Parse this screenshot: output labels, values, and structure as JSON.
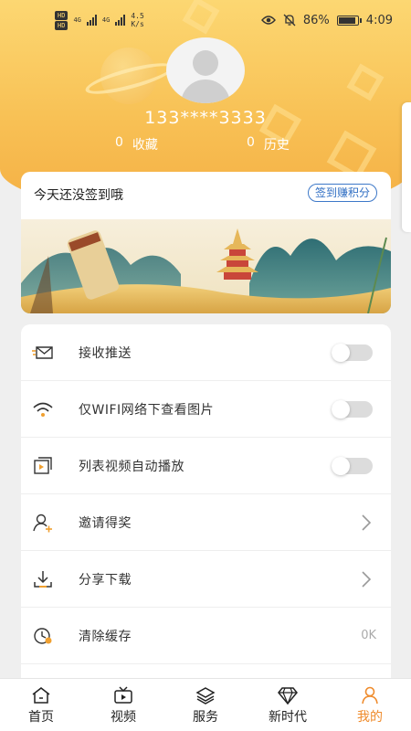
{
  "status_bar": {
    "network_tags": [
      "HD",
      "HD"
    ],
    "signal_labels": [
      "4G",
      "4G"
    ],
    "speed_value": "4.5",
    "speed_unit": "K/s",
    "battery": "86%",
    "time": "4:09",
    "icons": [
      "eye-icon",
      "mute-bell-icon",
      "battery-icon"
    ]
  },
  "profile": {
    "phone": "133****3333",
    "favorites_count": "0",
    "favorites_label": "收藏",
    "history_count": "0",
    "history_label": "历史"
  },
  "checkin": {
    "title": "今天还没签到哦",
    "button": "签到赚积分"
  },
  "settings": [
    {
      "label": "接收推送",
      "icon": "envelope-icon",
      "control": "toggle",
      "on": false
    },
    {
      "label": "仅WIFI网络下查看图片",
      "icon": "wifi-icon",
      "control": "toggle",
      "on": false
    },
    {
      "label": "列表视频自动播放",
      "icon": "video-play-icon",
      "control": "toggle",
      "on": false
    },
    {
      "label": "邀请得奖",
      "icon": "invite-user-icon",
      "control": "chevron"
    },
    {
      "label": "分享下载",
      "icon": "download-icon",
      "control": "chevron"
    },
    {
      "label": "清除缓存",
      "icon": "clock-clear-icon",
      "control": "value",
      "value": "0K"
    }
  ],
  "tabbar": [
    {
      "label": "首页",
      "icon": "home-icon",
      "active": false
    },
    {
      "label": "视频",
      "icon": "video-icon",
      "active": false
    },
    {
      "label": "服务",
      "icon": "layers-icon",
      "active": false
    },
    {
      "label": "新时代",
      "icon": "diamond-icon",
      "active": false
    },
    {
      "label": "我的",
      "icon": "person-icon",
      "active": true
    }
  ],
  "colors": {
    "accent": "#ef8b2c",
    "header": "#f8c155",
    "link_blue": "#2f6ec3"
  }
}
